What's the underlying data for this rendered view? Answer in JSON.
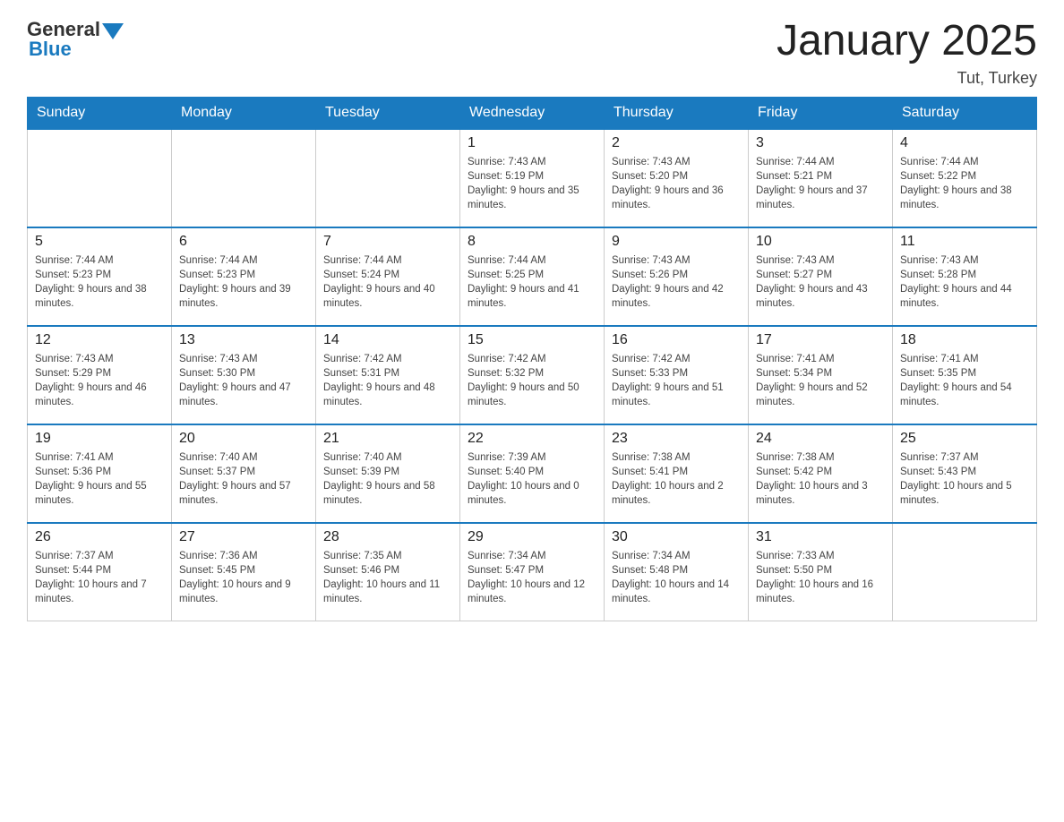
{
  "header": {
    "logo_general": "General",
    "logo_blue": "Blue",
    "title": "January 2025",
    "location": "Tut, Turkey"
  },
  "days_of_week": [
    "Sunday",
    "Monday",
    "Tuesday",
    "Wednesday",
    "Thursday",
    "Friday",
    "Saturday"
  ],
  "weeks": [
    [
      {
        "day": "",
        "info": ""
      },
      {
        "day": "",
        "info": ""
      },
      {
        "day": "",
        "info": ""
      },
      {
        "day": "1",
        "info": "Sunrise: 7:43 AM\nSunset: 5:19 PM\nDaylight: 9 hours and 35 minutes."
      },
      {
        "day": "2",
        "info": "Sunrise: 7:43 AM\nSunset: 5:20 PM\nDaylight: 9 hours and 36 minutes."
      },
      {
        "day": "3",
        "info": "Sunrise: 7:44 AM\nSunset: 5:21 PM\nDaylight: 9 hours and 37 minutes."
      },
      {
        "day": "4",
        "info": "Sunrise: 7:44 AM\nSunset: 5:22 PM\nDaylight: 9 hours and 38 minutes."
      }
    ],
    [
      {
        "day": "5",
        "info": "Sunrise: 7:44 AM\nSunset: 5:23 PM\nDaylight: 9 hours and 38 minutes."
      },
      {
        "day": "6",
        "info": "Sunrise: 7:44 AM\nSunset: 5:23 PM\nDaylight: 9 hours and 39 minutes."
      },
      {
        "day": "7",
        "info": "Sunrise: 7:44 AM\nSunset: 5:24 PM\nDaylight: 9 hours and 40 minutes."
      },
      {
        "day": "8",
        "info": "Sunrise: 7:44 AM\nSunset: 5:25 PM\nDaylight: 9 hours and 41 minutes."
      },
      {
        "day": "9",
        "info": "Sunrise: 7:43 AM\nSunset: 5:26 PM\nDaylight: 9 hours and 42 minutes."
      },
      {
        "day": "10",
        "info": "Sunrise: 7:43 AM\nSunset: 5:27 PM\nDaylight: 9 hours and 43 minutes."
      },
      {
        "day": "11",
        "info": "Sunrise: 7:43 AM\nSunset: 5:28 PM\nDaylight: 9 hours and 44 minutes."
      }
    ],
    [
      {
        "day": "12",
        "info": "Sunrise: 7:43 AM\nSunset: 5:29 PM\nDaylight: 9 hours and 46 minutes."
      },
      {
        "day": "13",
        "info": "Sunrise: 7:43 AM\nSunset: 5:30 PM\nDaylight: 9 hours and 47 minutes."
      },
      {
        "day": "14",
        "info": "Sunrise: 7:42 AM\nSunset: 5:31 PM\nDaylight: 9 hours and 48 minutes."
      },
      {
        "day": "15",
        "info": "Sunrise: 7:42 AM\nSunset: 5:32 PM\nDaylight: 9 hours and 50 minutes."
      },
      {
        "day": "16",
        "info": "Sunrise: 7:42 AM\nSunset: 5:33 PM\nDaylight: 9 hours and 51 minutes."
      },
      {
        "day": "17",
        "info": "Sunrise: 7:41 AM\nSunset: 5:34 PM\nDaylight: 9 hours and 52 minutes."
      },
      {
        "day": "18",
        "info": "Sunrise: 7:41 AM\nSunset: 5:35 PM\nDaylight: 9 hours and 54 minutes."
      }
    ],
    [
      {
        "day": "19",
        "info": "Sunrise: 7:41 AM\nSunset: 5:36 PM\nDaylight: 9 hours and 55 minutes."
      },
      {
        "day": "20",
        "info": "Sunrise: 7:40 AM\nSunset: 5:37 PM\nDaylight: 9 hours and 57 minutes."
      },
      {
        "day": "21",
        "info": "Sunrise: 7:40 AM\nSunset: 5:39 PM\nDaylight: 9 hours and 58 minutes."
      },
      {
        "day": "22",
        "info": "Sunrise: 7:39 AM\nSunset: 5:40 PM\nDaylight: 10 hours and 0 minutes."
      },
      {
        "day": "23",
        "info": "Sunrise: 7:38 AM\nSunset: 5:41 PM\nDaylight: 10 hours and 2 minutes."
      },
      {
        "day": "24",
        "info": "Sunrise: 7:38 AM\nSunset: 5:42 PM\nDaylight: 10 hours and 3 minutes."
      },
      {
        "day": "25",
        "info": "Sunrise: 7:37 AM\nSunset: 5:43 PM\nDaylight: 10 hours and 5 minutes."
      }
    ],
    [
      {
        "day": "26",
        "info": "Sunrise: 7:37 AM\nSunset: 5:44 PM\nDaylight: 10 hours and 7 minutes."
      },
      {
        "day": "27",
        "info": "Sunrise: 7:36 AM\nSunset: 5:45 PM\nDaylight: 10 hours and 9 minutes."
      },
      {
        "day": "28",
        "info": "Sunrise: 7:35 AM\nSunset: 5:46 PM\nDaylight: 10 hours and 11 minutes."
      },
      {
        "day": "29",
        "info": "Sunrise: 7:34 AM\nSunset: 5:47 PM\nDaylight: 10 hours and 12 minutes."
      },
      {
        "day": "30",
        "info": "Sunrise: 7:34 AM\nSunset: 5:48 PM\nDaylight: 10 hours and 14 minutes."
      },
      {
        "day": "31",
        "info": "Sunrise: 7:33 AM\nSunset: 5:50 PM\nDaylight: 10 hours and 16 minutes."
      },
      {
        "day": "",
        "info": ""
      }
    ]
  ]
}
